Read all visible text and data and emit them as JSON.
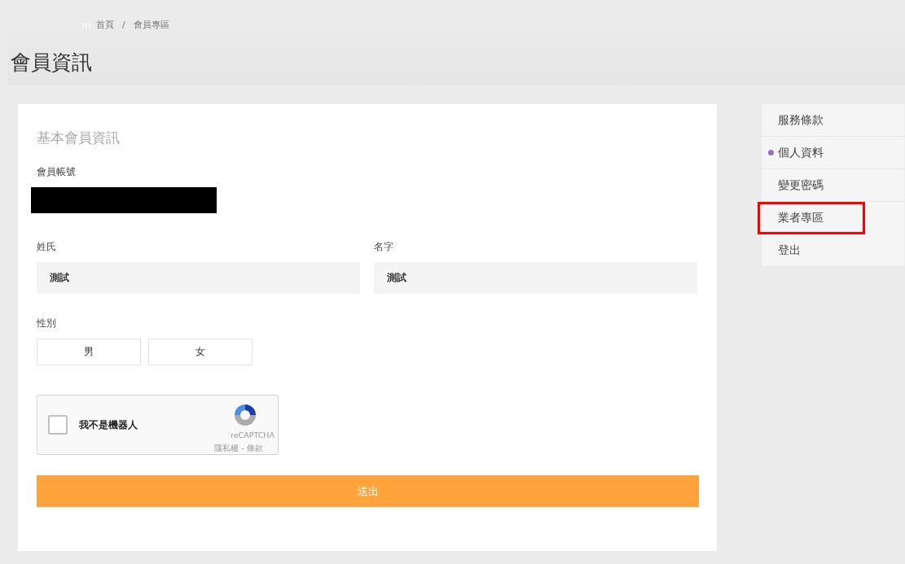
{
  "breadcrumb": [
    "首頁",
    "會員專區"
  ],
  "breadcrumb_separator": "/",
  "page_title": "會員資訊",
  "form": {
    "section_title": "基本會員資訊",
    "account": {
      "label": "會員帳號",
      "redacted": true
    },
    "last_name": {
      "label": "姓氏",
      "value": "測試"
    },
    "first_name": {
      "label": "名字",
      "value": "測試"
    },
    "gender": {
      "label": "性別",
      "options": [
        {
          "label": "男",
          "selected": false
        },
        {
          "label": "女",
          "selected": false
        }
      ]
    },
    "captcha": {
      "label": "我不是機器人",
      "checked": false,
      "brand": "reCAPTCHA",
      "links": "隱私權 - 條款"
    },
    "submit": "送出"
  },
  "sidebar": {
    "items": [
      {
        "label": "服務條款",
        "selected": false,
        "highlighted": false
      },
      {
        "label": "個人資料",
        "selected": true,
        "highlighted": false
      },
      {
        "label": "變更密碼",
        "selected": false,
        "highlighted": false
      },
      {
        "label": "業者專區",
        "selected": false,
        "highlighted": true
      },
      {
        "label": "登出",
        "selected": false,
        "highlighted": false
      }
    ]
  }
}
